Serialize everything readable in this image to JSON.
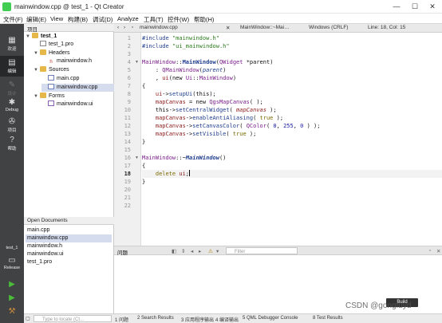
{
  "window": {
    "title": "mainwindow.cpp @ test_1 - Qt Creator",
    "minimize": "—",
    "maximize": "☐",
    "close": "✕"
  },
  "menu": [
    "文件(F)",
    "编辑(E)",
    "View",
    "构建(B)",
    "调试(D)",
    "Analyze",
    "工具(T)",
    "控件(W)",
    "帮助(H)"
  ],
  "modes": {
    "welcome": "欢迎",
    "edit": "编辑",
    "design": "设计",
    "debug": "Debug",
    "projects": "项目",
    "help": "帮助"
  },
  "target": {
    "project": "test_1",
    "config": "Release"
  },
  "project_panel": {
    "title": "项目",
    "tree": [
      {
        "label": "test_1"
      },
      {
        "label": "test_1.pro"
      },
      {
        "label": "Headers"
      },
      {
        "label": "mainwindow.h"
      },
      {
        "label": "Sources"
      },
      {
        "label": "main.cpp"
      },
      {
        "label": "mainwindow.cpp"
      },
      {
        "label": "Forms"
      },
      {
        "label": "mainwindow.ui"
      }
    ]
  },
  "open_documents": {
    "title": "Open Documents",
    "items": [
      "main.cpp",
      "mainwindow.cpp",
      "mainwindow.h",
      "mainwindow.ui",
      "test_1.pro"
    ]
  },
  "editor": {
    "file_tab": "mainwindow.cpp",
    "symbol": "MainWindow::~Mai…",
    "encoding": "Windows (CRLF)",
    "position": "Line: 18, Col: 15",
    "line_numbers": [
      "1",
      "2",
      "3",
      "4",
      "5",
      "6",
      "7",
      "8",
      "9",
      "10",
      "11",
      "12",
      "13",
      "14",
      "15",
      "16",
      "17",
      "18",
      "19",
      "20",
      "21",
      "22"
    ],
    "lines": {
      "l1a": "#include ",
      "l1b": "\"mainwindow.h\"",
      "l2a": "#include ",
      "l2b": "\"ui_mainwindow.h\"",
      "l4a": "MainWindow",
      "l4b": "::",
      "l4c": "MainWindow",
      "l4d": "(",
      "l4e": "QWidget",
      "l4f": " *parent)",
      "l5a": "    : ",
      "l5b": "QMainWindow",
      "l5c": "(",
      "l5d": "parent",
      "l5e": ")",
      "l6a": "    , ",
      "l6b": "ui",
      "l6c": "(new ",
      "l6d": "Ui",
      "l6e": "::",
      "l6f": "MainWindow",
      "l6g": ")",
      "l7": "{",
      "l8a": "    ",
      "l8b": "ui",
      "l8c": "->",
      "l8d": "setupUi",
      "l8e": "(this);",
      "l9a": "    ",
      "l9b": "mapCanvas",
      "l9c": " = new ",
      "l9d": "QgsMapCanvas",
      "l9e": "( );",
      "l10a": "    this->",
      "l10b": "setCentralWidget",
      "l10c": "( ",
      "l10d": "mapCanvas",
      "l10e": " );",
      "l11a": "    ",
      "l11b": "mapCanvas",
      "l11c": "->",
      "l11d": "enableAntiAliasing",
      "l11e": "( ",
      "l11f": "true",
      "l11g": " );",
      "l12a": "    ",
      "l12b": "mapCanvas",
      "l12c": "->",
      "l12d": "setCanvasColor",
      "l12e": "( ",
      "l12f": "QColor",
      "l12g": "( ",
      "l12h": "0",
      "l12i": ", ",
      "l12j": "255",
      "l12k": ", ",
      "l12l": "0",
      "l12m": " ) );",
      "l13a": "    ",
      "l13b": "mapCanvas",
      "l13c": "->",
      "l13d": "setVisible",
      "l13e": "( ",
      "l13f": "true",
      "l13g": " );",
      "l14": "}",
      "l16a": "MainWindow",
      "l16b": "::~",
      "l16c": "MainWindow",
      "l16d": "()",
      "l17": "{",
      "l18a": "    delete ",
      "l18b": "ui",
      "l18c": ";",
      "l19": "}"
    }
  },
  "issues": {
    "title": "问题",
    "filter_placeholder": "Filter"
  },
  "statusbar": {
    "locate_placeholder": "Type to locate (Ct…",
    "tabs": [
      "1 问题",
      "2 Search Results",
      "3 应用程序输出",
      "4 编译输出",
      "5 QML Debugger Console",
      "8 Test Results"
    ]
  },
  "build_tooltip": "Build",
  "watermark": "CSDN @gongfuyd",
  "colors": {
    "mode_bar": "#404244",
    "selection": "#d5dcee",
    "keyword": "#7b6a00",
    "string": "#2a7a1b",
    "type": "#7a1f8a"
  }
}
